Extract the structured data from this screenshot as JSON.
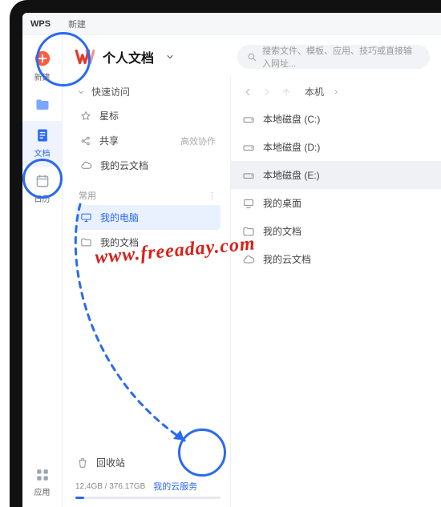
{
  "titlebar": {
    "app": "WPS",
    "new_tab": "新建"
  },
  "header": {
    "title": "个人文档"
  },
  "search": {
    "placeholder": "搜索文件、模板、应用、技巧或直接输入网址..."
  },
  "rail": {
    "new": "新建",
    "docs": "文档",
    "calendar": "日历",
    "apps": "应用"
  },
  "left": {
    "quick_access": "快速访问",
    "star": "星标",
    "share": "共享",
    "share_hint": "高效协作",
    "my_cloud_docs": "我的云文档",
    "frequent": "常用",
    "my_computer": "我的电脑",
    "my_docs": "我的文档",
    "recycle": "回收站",
    "storage": "12.4GB / 376.17GB",
    "cloud_service": "我的云服务"
  },
  "right": {
    "location": "本机",
    "drives": [
      "本地磁盘 (C:)",
      "本地磁盘 (D:)",
      "本地磁盘 (E:)",
      "我的桌面",
      "我的文档",
      "我的云文档"
    ]
  },
  "watermark": "www.freeaday.com",
  "colors": {
    "accent": "#2a6af2"
  }
}
